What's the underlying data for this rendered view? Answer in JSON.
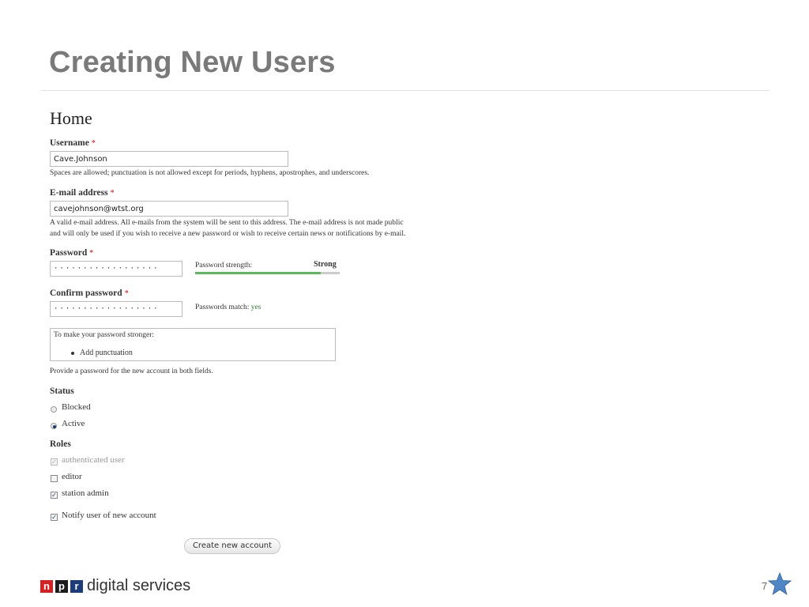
{
  "slide": {
    "title": "Creating New Users",
    "page_number": "7"
  },
  "page": {
    "heading": "Home"
  },
  "username": {
    "label": "Username",
    "required": "*",
    "value": "Cave.Johnson",
    "description": "Spaces are allowed; punctuation is not allowed except for periods, hyphens, apostrophes, and underscores."
  },
  "email": {
    "label": "E-mail address",
    "required": "*",
    "value": "cavejohnson@wtst.org",
    "description_line1": "A valid e-mail address. All e-mails from the system will be sent to this address. The e-mail address is not made public",
    "description_line2": "and will only be used if you wish to receive a new password or wish to receive certain news or notifications by e-mail."
  },
  "password": {
    "label": "Password",
    "required": "*",
    "masked_value": "··················",
    "strength_label": "Password strength:",
    "strength_value": "Strong",
    "strength_fraction": 0.87
  },
  "confirm_password": {
    "label": "Confirm password",
    "required": "*",
    "masked_value": "··················",
    "match_label": "Passwords match:",
    "match_value": "yes"
  },
  "password_suggestions": {
    "intro": "To make your password stronger:",
    "items": [
      "Add punctuation"
    ],
    "footer": "Provide a password for the new account in both fields."
  },
  "status": {
    "label": "Status",
    "options": [
      {
        "label": "Blocked",
        "selected": false
      },
      {
        "label": "Active",
        "selected": true
      }
    ]
  },
  "roles": {
    "label": "Roles",
    "options": [
      {
        "label": "authenticated user",
        "checked": true,
        "disabled": true
      },
      {
        "label": "editor",
        "checked": false,
        "disabled": false
      },
      {
        "label": "station admin",
        "checked": true,
        "disabled": false
      }
    ]
  },
  "notify": {
    "label": "Notify user of new account",
    "checked": true
  },
  "submit": {
    "label": "Create new account"
  },
  "footer": {
    "brand_letters": [
      "n",
      "p",
      "r"
    ],
    "brand_text": "digital services",
    "brand_color": "#d62021",
    "brand_color_alt": "#1c3c7a"
  },
  "colors": {
    "required": "#dd0000",
    "meter": "#5cb85c",
    "match_yes": "#2e7d32",
    "star": "#4f86c6"
  }
}
